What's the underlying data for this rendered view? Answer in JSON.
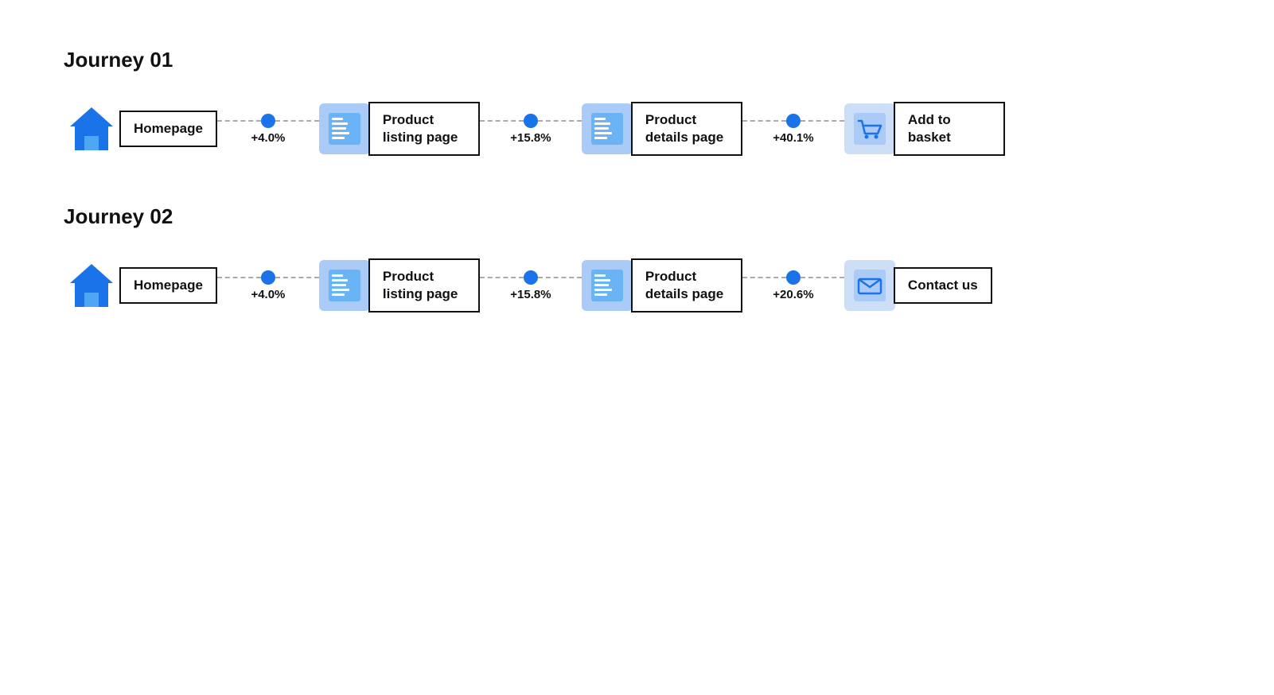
{
  "journeys": [
    {
      "id": "journey-01",
      "title": "Journey 01",
      "steps": [
        {
          "icon": "home",
          "label": "Homepage",
          "multiline": false
        },
        {
          "connector_pct": "+4.0%"
        },
        {
          "icon": "listing",
          "label": "Product listing page",
          "multiline": true
        },
        {
          "connector_pct": "+15.8%"
        },
        {
          "icon": "listing",
          "label": "Product details page",
          "multiline": true
        },
        {
          "connector_pct": "+40.1%"
        },
        {
          "icon": "cart",
          "label": "Add to basket",
          "multiline": true
        }
      ]
    },
    {
      "id": "journey-02",
      "title": "Journey 02",
      "steps": [
        {
          "icon": "home",
          "label": "Homepage",
          "multiline": false
        },
        {
          "connector_pct": "+4.0%"
        },
        {
          "icon": "listing",
          "label": "Product listing page",
          "multiline": true
        },
        {
          "connector_pct": "+15.8%"
        },
        {
          "icon": "listing",
          "label": "Product details page",
          "multiline": true
        },
        {
          "connector_pct": "+20.6%"
        },
        {
          "icon": "mail",
          "label": "Contact us",
          "multiline": true
        }
      ]
    }
  ]
}
